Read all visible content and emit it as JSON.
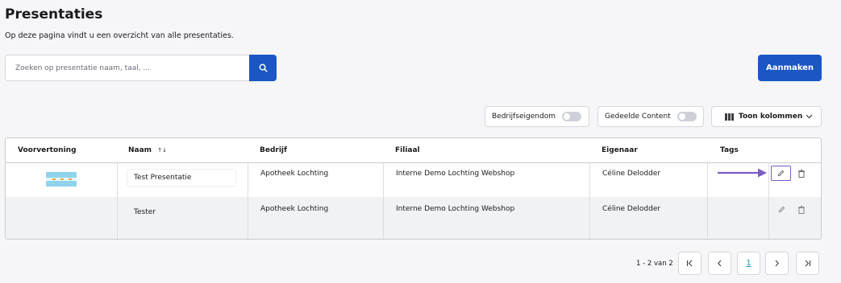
{
  "page": {
    "title": "Presentaties",
    "subtitle": "Op deze pagina vindt u een overzicht van alle presentaties."
  },
  "search": {
    "placeholder": "Zoeken op presentatie naam, taal, ...",
    "value": "",
    "button_icon": "search-icon"
  },
  "actions": {
    "create_label": "Aanmaken"
  },
  "filters": {
    "company_property_label": "Bedrijfseigendom",
    "company_property_on": false,
    "shared_content_label": "Gedeelde Content",
    "shared_content_on": false,
    "columns_label": "Toon kolommen"
  },
  "table": {
    "columns": [
      "Voorvertoning",
      "Naam",
      "Bedrijf",
      "Filiaal",
      "Eigenaar",
      "Tags"
    ],
    "sort_indicator": "↑↓",
    "rows": [
      {
        "name": "Test Presentatie",
        "company": "Apotheek Lochting",
        "branch": "Interne Demo Lochting Webshop",
        "owner": "Céline Delodder",
        "tags": "",
        "has_preview": true
      },
      {
        "name": "Tester",
        "company": "Apotheek Lochting",
        "branch": "Interne Demo Lochting Webshop",
        "owner": "Céline Delodder",
        "tags": "",
        "has_preview": false
      }
    ]
  },
  "pagination": {
    "info": "1 - 2 van 2",
    "current_page": "1"
  },
  "colors": {
    "primary": "#1a56c4",
    "highlight_arrow": "#7c5cc4",
    "page_link": "#1a9ab0"
  }
}
